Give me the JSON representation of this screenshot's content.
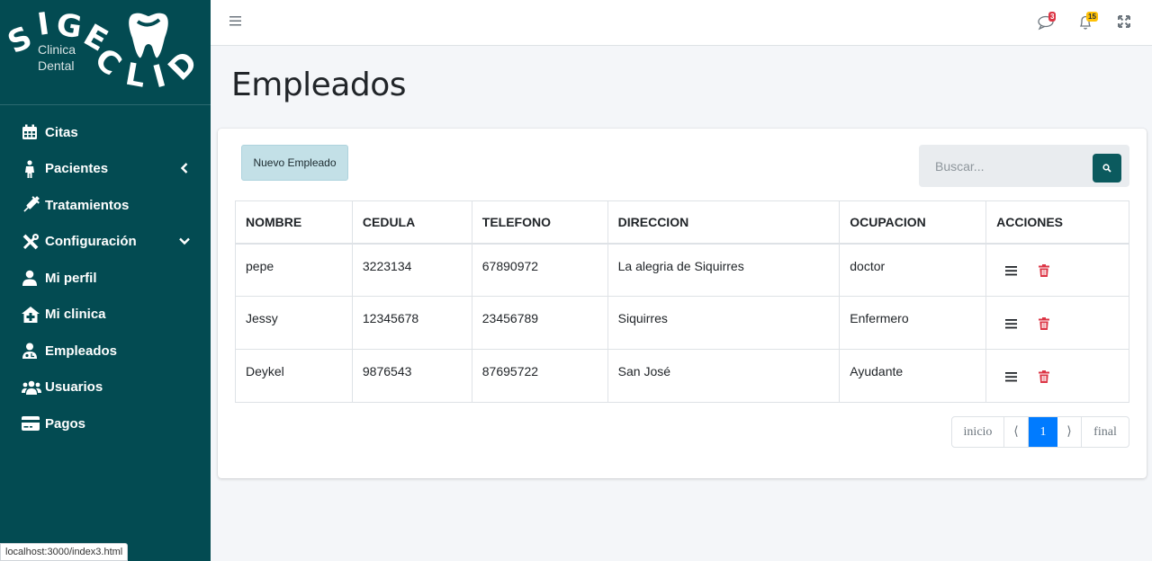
{
  "brand": {
    "letters": [
      "S",
      "I",
      "G",
      "E",
      "C",
      "L",
      "I",
      "D"
    ],
    "subtitle_line1": "Clinica",
    "subtitle_line2": "Dental",
    "tooth_icon": "tooth-icon"
  },
  "sidebar": {
    "items": [
      {
        "label": "Citas",
        "icon": "calendar-icon"
      },
      {
        "label": "Pacientes",
        "icon": "person-icon",
        "chevron": "left"
      },
      {
        "label": "Tratamientos",
        "icon": "syringe-icon"
      },
      {
        "label": "Configuración",
        "icon": "tools-icon",
        "chevron": "down"
      },
      {
        "label": "Mi perfil",
        "icon": "user-icon"
      },
      {
        "label": "Mi clinica",
        "icon": "clinic-icon"
      },
      {
        "label": "Empleados",
        "icon": "user-md-icon"
      },
      {
        "label": "Usuarios",
        "icon": "users-icon"
      },
      {
        "label": "Pagos",
        "icon": "credit-card-icon"
      }
    ]
  },
  "topbar": {
    "messages_badge": "3",
    "notifications_badge": "15",
    "colors": {
      "messages_badge": "#dc3545",
      "notifications_badge": "#ffc107"
    }
  },
  "page": {
    "title": "Empleados"
  },
  "toolbar": {
    "new_button_label": "Nuevo Empleado",
    "search_placeholder": "Buscar..."
  },
  "table": {
    "headers": [
      "NOMBRE",
      "CEDULA",
      "TELEFONO",
      "DIRECCION",
      "OCUPACION",
      "ACCIONES"
    ],
    "rows": [
      [
        "pepe",
        "3223134",
        "67890972",
        "La alegria de Siquirres",
        "doctor"
      ],
      [
        "Jessy",
        "12345678",
        "23456789",
        "Siquirres",
        "Enfermero"
      ],
      [
        "Deykel",
        "9876543",
        "87695722",
        "San José",
        "Ayudante"
      ]
    ]
  },
  "pagination": {
    "first": "inicio",
    "prev": "⟨",
    "current": "1",
    "next": "⟩",
    "last": "final"
  },
  "status_bar": {
    "url": "localhost:3000/index3.html"
  },
  "colors": {
    "sidebar": "#034b52",
    "accent": "#0b5a5e",
    "delete": "#dc3545",
    "pager_active": "#007bff"
  }
}
